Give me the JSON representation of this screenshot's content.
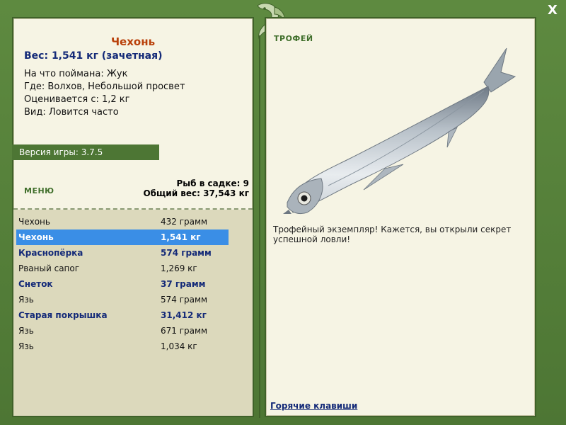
{
  "window": {
    "close_label": "X"
  },
  "fish_info": {
    "title": "Чехонь",
    "weight_line": "Вес: 1,541 кг (зачетная)",
    "caught_on": "На что поймана: Жук",
    "location": "Где: Волхов, Небольшой просвет",
    "valued_from": "Оценивается с: 1,2 кг",
    "frequency": "Вид: Ловится часто"
  },
  "version": "Версия игры: 3.7.5",
  "menu_label": "МЕНЮ",
  "keepnet": {
    "count_line": "Рыб в садке: 9",
    "total_line": "Общий вес: 37,543 кг"
  },
  "catch_list": [
    {
      "name": "Чехонь",
      "weight": "432 грамм",
      "style": "normal"
    },
    {
      "name": "Чехонь",
      "weight": "1,541 кг",
      "style": "selected"
    },
    {
      "name": "Краснопёрка",
      "weight": "574 грамм",
      "style": "bold"
    },
    {
      "name": "Рваный сапог",
      "weight": "1,269 кг",
      "style": "normal"
    },
    {
      "name": "Снеток",
      "weight": "37 грамм",
      "style": "bold"
    },
    {
      "name": "Язь",
      "weight": "574 грамм",
      "style": "normal"
    },
    {
      "name": "Старая покрышка",
      "weight": "31,412 кг",
      "style": "bold"
    },
    {
      "name": "Язь",
      "weight": "671 грамм",
      "style": "normal"
    },
    {
      "name": "Язь",
      "weight": "1,034 кг",
      "style": "normal"
    }
  ],
  "trophy": {
    "label": "ТРОФЕЙ",
    "message": "Трофейный экземпляр! Кажется, вы открыли секрет успешной ловли!",
    "hotkeys_link": "Горячие клавиши"
  },
  "icons": {
    "close": "close-icon",
    "logo": "fish-ornament-icon",
    "fish_picture": "fish-picture"
  },
  "colors": {
    "frame_green": "#4f7a36",
    "panel_bg": "#f6f4e4",
    "list_bg": "#dcd9bc",
    "title_orange": "#b9400a",
    "accent_blue": "#142a78",
    "selection_blue": "#3a8ee6"
  }
}
